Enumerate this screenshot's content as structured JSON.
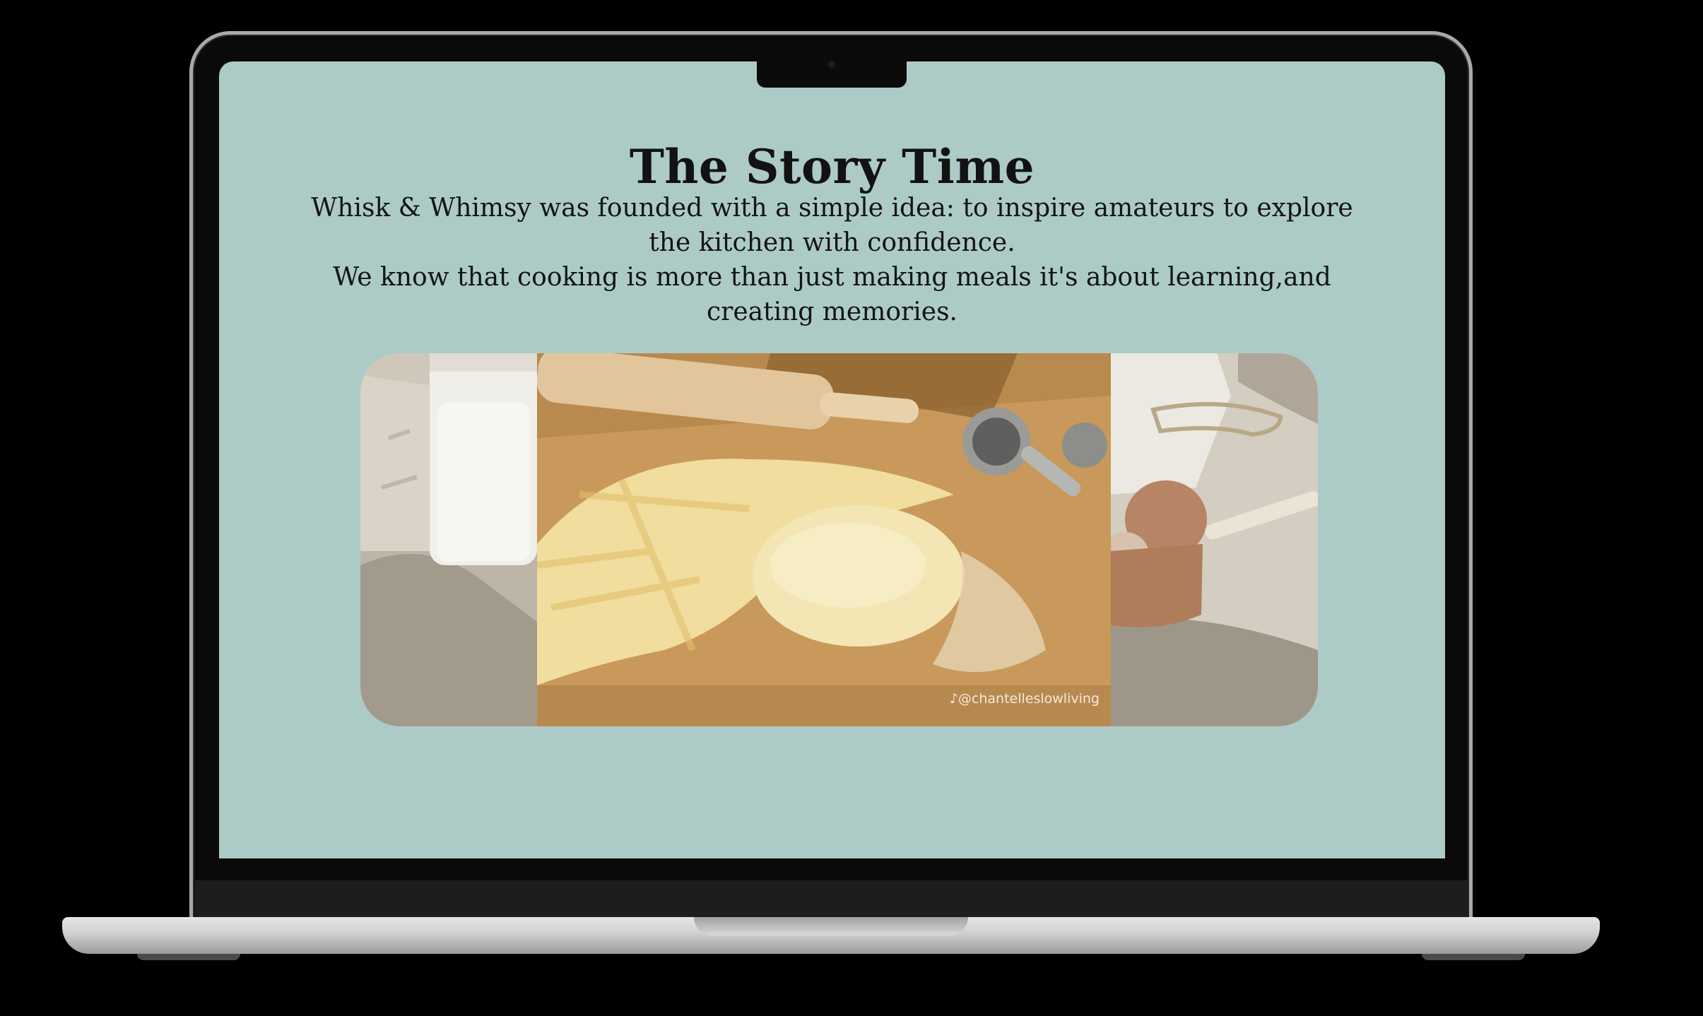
{
  "page": {
    "title": "The Story Time",
    "paragraphs": [
      "Whisk & Whimsy was founded with a simple idea: to inspire amateurs to explore the kitchen with confidence.",
      "We know that cooking is more than just making meals it's about learning,and creating memories."
    ]
  },
  "gallery": {
    "photos": [
      {
        "icon": "milk-jar-photo"
      },
      {
        "icon": "bread-dough-photo",
        "watermark": "♪@chantelleslowliving"
      },
      {
        "icon": "eggs-measuring-cup-photo"
      }
    ]
  },
  "colors": {
    "screen_background": "#adcbc6",
    "text": "#141414",
    "laptop_frame": "#a9a9a9"
  }
}
